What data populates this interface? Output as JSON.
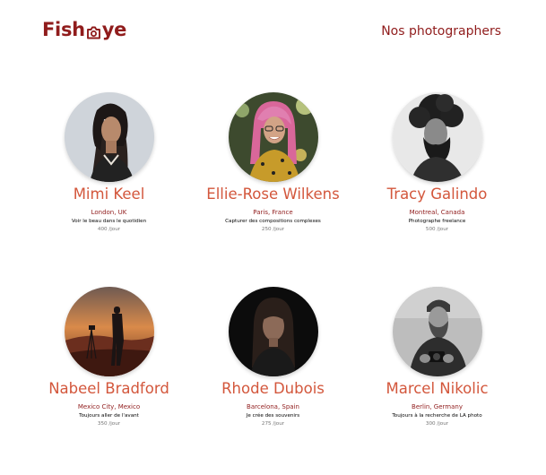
{
  "header": {
    "logo_left": "Fish",
    "logo_right": "ye",
    "page_title": "Nos photographers"
  },
  "photographers": [
    {
      "name": "Mimi Keel",
      "location": "London, UK",
      "tagline": "Voir le beau dans le quotidien",
      "price": "400 /jour"
    },
    {
      "name": "Ellie-Rose Wilkens",
      "location": "Paris, France",
      "tagline": "Capturer des compositions complexes",
      "price": "250 /jour"
    },
    {
      "name": "Tracy Galindo",
      "location": "Montreal, Canada",
      "tagline": "Photographe freelance",
      "price": "500 /jour"
    },
    {
      "name": "Nabeel Bradford",
      "location": "Mexico City, Mexico",
      "tagline": "Toujours aller de l'avant",
      "price": "350 /jour"
    },
    {
      "name": "Rhode Dubois",
      "location": "Barcelona, Spain",
      "tagline": "Je crée des souvenirs",
      "price": "275 /jour"
    },
    {
      "name": "Marcel Nikolic",
      "location": "Berlin, Germany",
      "tagline": "Toujours à la recherche de LA photo",
      "price": "300 /jour"
    }
  ],
  "colors": {
    "brand": "#901C1C",
    "name": "#D3573C",
    "price": "#757575"
  }
}
